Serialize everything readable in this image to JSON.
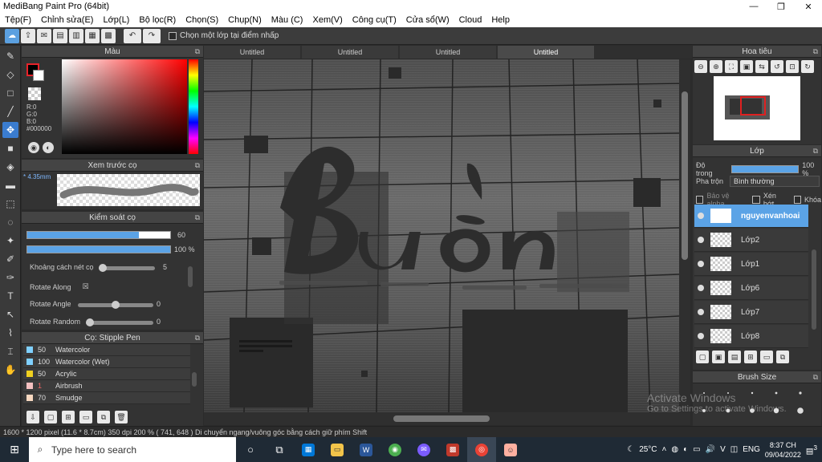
{
  "app": {
    "title": "MediBang Paint Pro (64bit)"
  },
  "window": {
    "minimize": "—",
    "maximize": "❐",
    "close": "✕"
  },
  "menu": [
    "Tệp(F)",
    "Chỉnh sửa(E)",
    "Lớp(L)",
    "Bộ lọc(R)",
    "Chọn(S)",
    "Chụp(N)",
    "Màu (C)",
    "Xem(V)",
    "Công cụ(T)",
    "Cửa sổ(W)",
    "Cloud",
    "Help"
  ],
  "toolbar": {
    "checkbox_label": "Chọn một lớp tại điểm nhấp"
  },
  "tabs": [
    "Untitled",
    "Untitled",
    "Untitled",
    "Untitled"
  ],
  "active_tab_index": 3,
  "color_panel": {
    "title": "Màu",
    "r": "R:0",
    "g": "G:0",
    "b": "B:0",
    "hex": "#000000"
  },
  "brush_preview": {
    "title": "Xem trước cọ",
    "size": "* 4.35mm"
  },
  "brush_control": {
    "title": "Kiểm soát cọ",
    "size_value": "60",
    "size_fraction": 0.78,
    "opacity_value": "100 %",
    "opacity_fraction": 1.0,
    "spacing_label": "Khoảng cách nét cọ",
    "spacing_value": "5",
    "rotate_along_label": "Rotate Along",
    "rotate_along_mark": "☒",
    "rotate_angle_label": "Rotate Angle",
    "rotate_angle_value": "0",
    "rotate_random_label": "Rotate Random",
    "rotate_random_value": "0"
  },
  "brush_list": {
    "title": "Cọ: Stipple Pen",
    "items": [
      {
        "size": "50",
        "name": "Watercolor",
        "color": "#7fd0ff"
      },
      {
        "size": "100",
        "name": "Watercolor (Wet)",
        "color": "#7fd0ff"
      },
      {
        "size": "50",
        "name": "Acrylic",
        "color": "#f0d020"
      },
      {
        "size": "1",
        "name": "Airbrush",
        "color": "#f4c0c0"
      },
      {
        "size": "70",
        "name": "Smudge",
        "color": "#f8d8c0"
      }
    ]
  },
  "navigator": {
    "title": "Hoa tiêu"
  },
  "layers": {
    "title": "Lớp",
    "opacity_label": "Độ trong",
    "opacity_value": "100 %",
    "blend_label": "Pha trộn",
    "blend_value": "Bình thường",
    "protect_alpha": "Bảo vệ alpha",
    "clipping": "Xén bớt",
    "lock": "Khóa",
    "items": [
      {
        "name": "nguyenvanhoai",
        "selected": true
      },
      {
        "name": "Lớp2",
        "selected": false
      },
      {
        "name": "Lớp1",
        "selected": false
      },
      {
        "name": "Lớp6",
        "selected": false
      },
      {
        "name": "Lớp7",
        "selected": false
      },
      {
        "name": "Lớp8",
        "selected": false
      }
    ]
  },
  "brush_size_panel": {
    "title": "Brush Size"
  },
  "watermark": {
    "line1": "Activate Windows",
    "line2": "Go to Settings to activate Windows."
  },
  "status": "1600 * 1200 pixel   (11.6 * 8.7cm)   350 dpi   200 %   ( 741, 648 )   Di chuyển ngang/vuông góc bằng cách giữ phím Shift",
  "taskbar": {
    "search_placeholder": "Type here to search",
    "temperature": "25°C",
    "language": "ENG",
    "time": "8:37 CH",
    "date": "09/04/2022",
    "notifications": "3"
  },
  "canvas_text": "Buồn",
  "colors": {
    "accent": "#5ba3e6",
    "primary_fg": "#000000",
    "primary_bg": "#ffffff"
  }
}
